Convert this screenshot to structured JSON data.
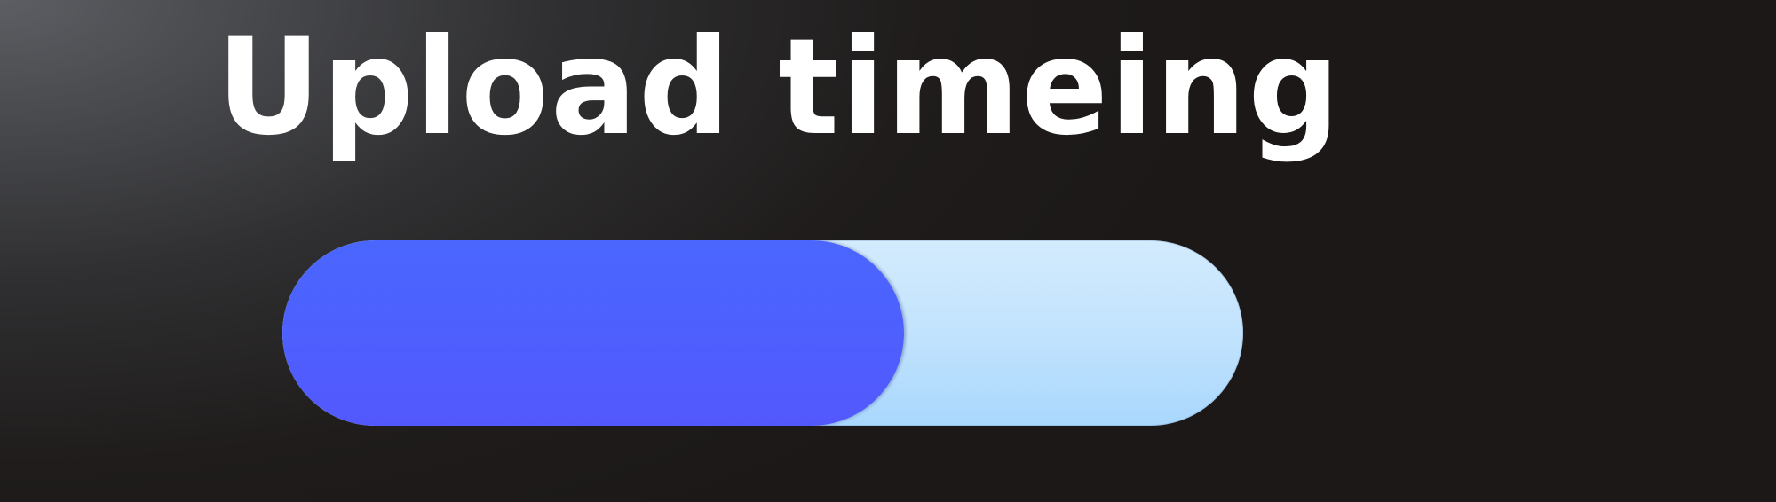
{
  "upload": {
    "title": "Upload timeing",
    "progress_fraction": 0.647
  },
  "colors": {
    "fill": "#4e5ffe",
    "track": "#c2e3fd",
    "title": "#ffffff"
  }
}
